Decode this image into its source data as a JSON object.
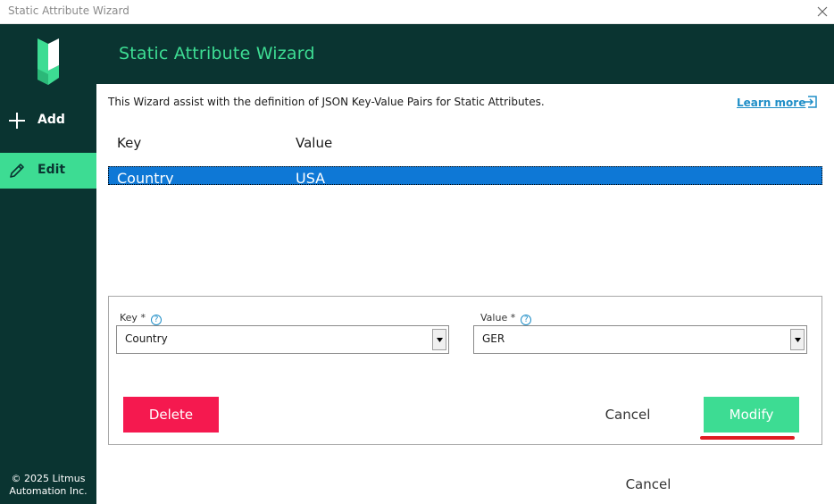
{
  "window": {
    "title": "Static Attribute Wizard",
    "close_icon": "close-icon"
  },
  "sidebar": {
    "logo_icon": "litmus-logo",
    "items": [
      {
        "label": "Add",
        "icon": "plus-icon",
        "active": false
      },
      {
        "label": "Edit",
        "icon": "pencil-icon",
        "active": true
      }
    ],
    "copyright_line1": "© 2025 Litmus",
    "copyright_line2": "Automation Inc."
  },
  "header": {
    "title": "Static Attribute Wizard"
  },
  "intro": {
    "description": "This Wizard assist with the definition of JSON Key-Value Pairs for Static Attributes.",
    "learn_more": "Learn more",
    "learn_more_icon": "external-link-icon"
  },
  "table": {
    "columns": [
      "Key",
      "Value"
    ],
    "rows": [
      {
        "key": "Country",
        "value": "USA",
        "selected": true
      }
    ]
  },
  "form": {
    "key_label": "Key *",
    "key_value": "Country",
    "value_label": "Value *",
    "value_value": "GER",
    "help_glyph": "?",
    "delete_label": "Delete",
    "cancel_label": "Cancel",
    "modify_label": "Modify"
  },
  "footer": {
    "cancel_label": "Cancel"
  },
  "colors": {
    "brand_dark": "#0a3431",
    "accent_green": "#3ddc93",
    "delete_red": "#f5194f",
    "selection_blue": "#0e78d6",
    "link_blue": "#1f8ec7"
  }
}
